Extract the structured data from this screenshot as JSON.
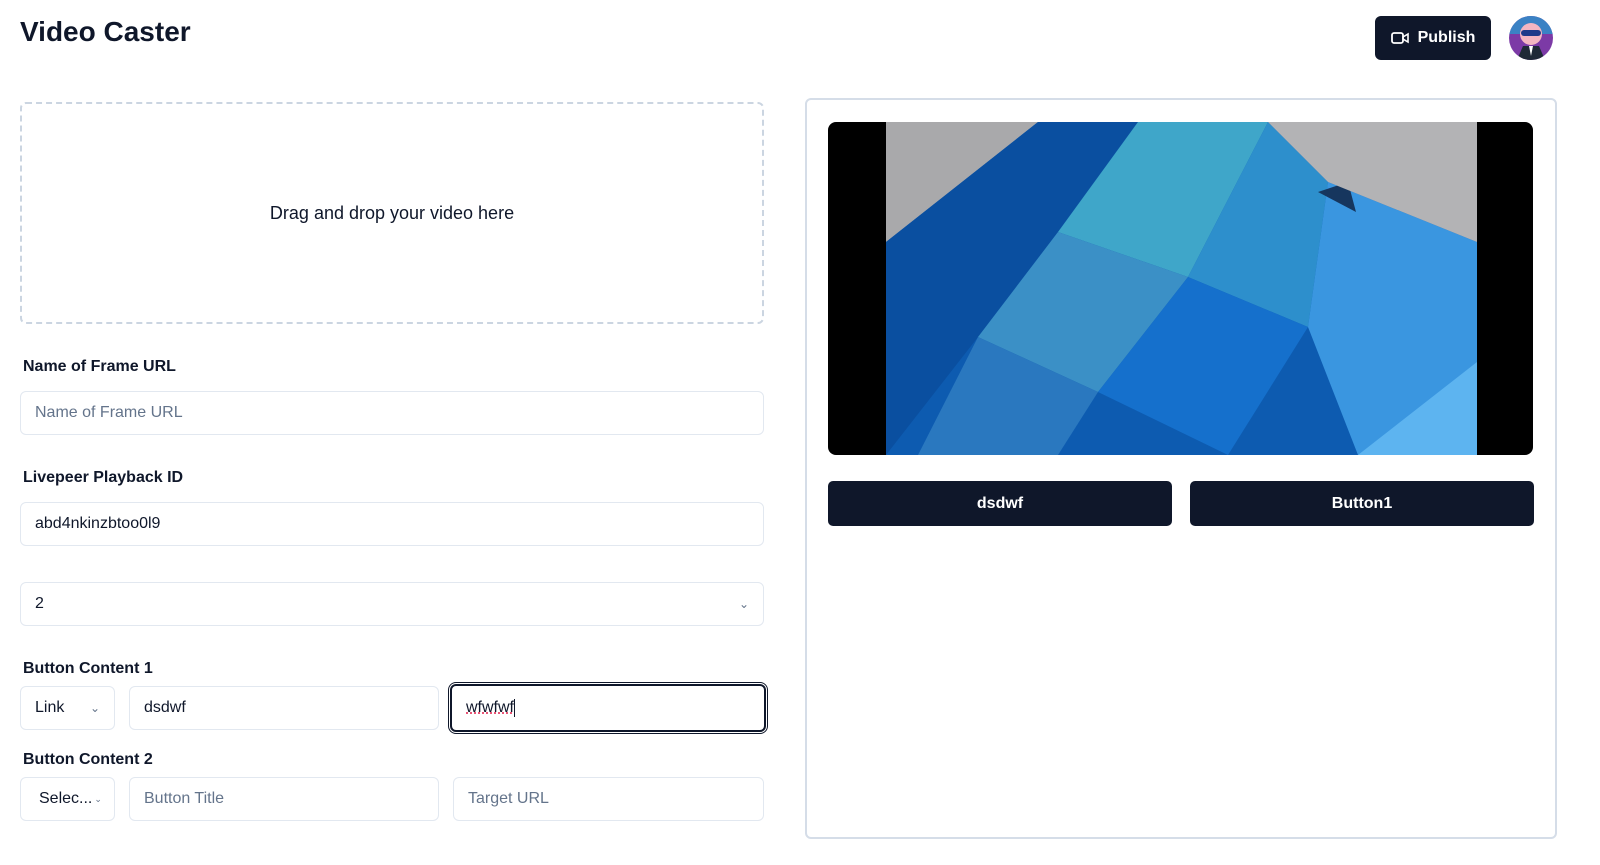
{
  "header": {
    "title": "Video Caster",
    "publish_label": "Publish",
    "publish_icon": "video-camera-icon"
  },
  "upload": {
    "text": "Drag and drop your video here"
  },
  "form": {
    "frame_url": {
      "label": "Name of Frame URL",
      "placeholder": "Name of Frame URL",
      "value": ""
    },
    "playback": {
      "label": "Livepeer Playback ID",
      "value": "abd4nkinzbtoo0l9"
    },
    "button_count": {
      "value": "2"
    },
    "button1": {
      "label": "Button Content 1",
      "type": "Link",
      "title": "dsdwf",
      "target": "wfwfwf"
    },
    "button2": {
      "label": "Button Content 2",
      "type": "Selec...",
      "title_placeholder": "Button Title",
      "target_placeholder": "Target URL"
    }
  },
  "preview": {
    "buttons": [
      "dsdwf",
      "Button1"
    ]
  },
  "colors": {
    "primary": "#0f172a",
    "border": "#e2e8f0"
  }
}
